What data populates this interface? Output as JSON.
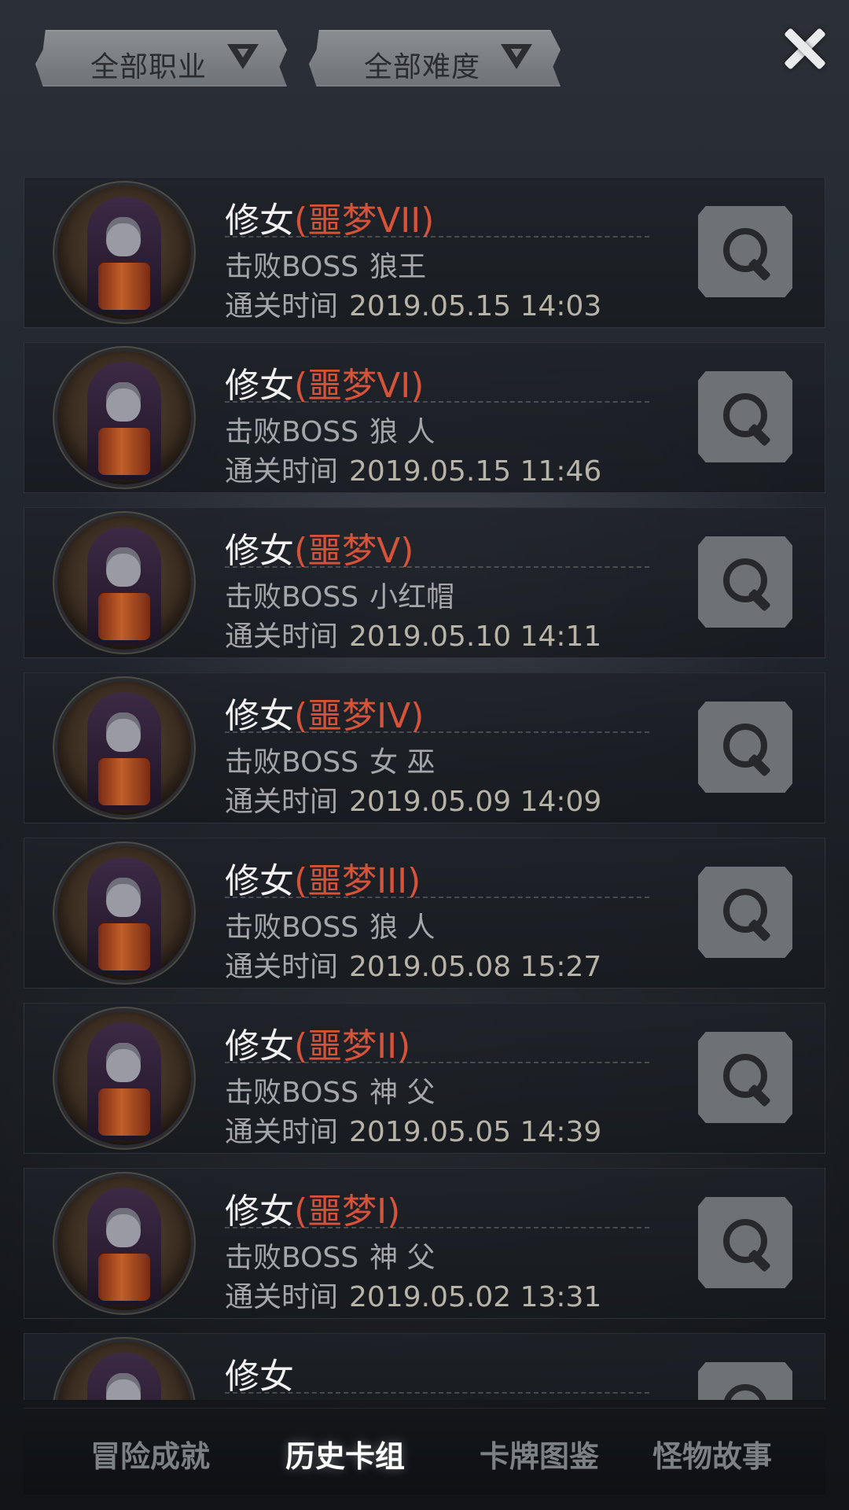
{
  "filters": {
    "class_label": "全部职业",
    "difficulty_label": "全部难度"
  },
  "records": [
    {
      "name": "修女",
      "difficulty": "(噩梦VII)",
      "boss_label": "击败BOSS",
      "boss": "狼王",
      "time_label": "通关时间",
      "time": "2019.05.15 14:03"
    },
    {
      "name": "修女",
      "difficulty": "(噩梦VI)",
      "boss_label": "击败BOSS",
      "boss": "狼 人",
      "time_label": "通关时间",
      "time": "2019.05.15 11:46"
    },
    {
      "name": "修女",
      "difficulty": "(噩梦V)",
      "boss_label": "击败BOSS",
      "boss": "小红帽",
      "time_label": "通关时间",
      "time": "2019.05.10 14:11"
    },
    {
      "name": "修女",
      "difficulty": "(噩梦IV)",
      "boss_label": "击败BOSS",
      "boss": "女 巫",
      "time_label": "通关时间",
      "time": "2019.05.09 14:09"
    },
    {
      "name": "修女",
      "difficulty": "(噩梦III)",
      "boss_label": "击败BOSS",
      "boss": "狼 人",
      "time_label": "通关时间",
      "time": "2019.05.08 15:27"
    },
    {
      "name": "修女",
      "difficulty": "(噩梦II)",
      "boss_label": "击败BOSS",
      "boss": "神 父",
      "time_label": "通关时间",
      "time": "2019.05.05 14:39"
    },
    {
      "name": "修女",
      "difficulty": "(噩梦I)",
      "boss_label": "击败BOSS",
      "boss": "神 父",
      "time_label": "通关时间",
      "time": "2019.05.02 13:31"
    },
    {
      "name": "修女",
      "difficulty": "",
      "boss_label": "",
      "boss": "",
      "time_label": "",
      "time": ""
    }
  ],
  "tabs": [
    {
      "label": "冒险成就",
      "active": false
    },
    {
      "label": "历史卡组",
      "active": true
    },
    {
      "label": "卡牌图鉴",
      "active": false
    },
    {
      "label": "怪物故事",
      "active": false
    }
  ],
  "icons": {
    "close": "close-icon",
    "detail": "magnifier-icon",
    "dropdown": "triangle-down-icon"
  },
  "colors": {
    "difficulty": "#d6533a",
    "active_tab": "#ffffff",
    "inactive_tab": "#7d8186"
  }
}
